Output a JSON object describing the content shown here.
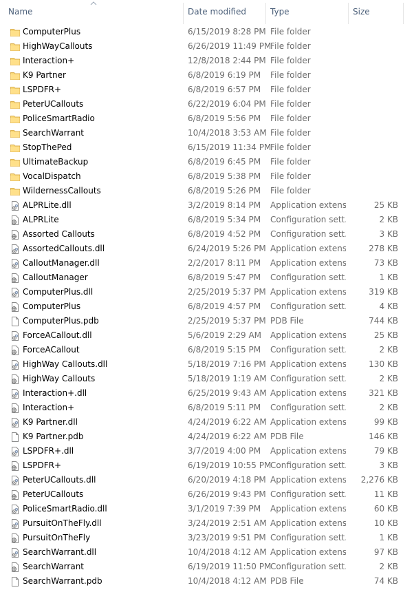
{
  "header": {
    "name": "Name",
    "date_modified": "Date modified",
    "type": "Type",
    "size": "Size"
  },
  "files": [
    {
      "name": "ComputerPlus",
      "date": "6/15/2019 8:28 PM",
      "type": "File folder",
      "size": "",
      "icon": "folder-icon"
    },
    {
      "name": "HighWayCallouts",
      "date": "6/26/2019 11:49 PM",
      "type": "File folder",
      "size": "",
      "icon": "folder-icon"
    },
    {
      "name": "Interaction+",
      "date": "12/8/2018 2:44 PM",
      "type": "File folder",
      "size": "",
      "icon": "folder-icon"
    },
    {
      "name": "K9 Partner",
      "date": "6/8/2019 6:19 PM",
      "type": "File folder",
      "size": "",
      "icon": "folder-icon"
    },
    {
      "name": "LSPDFR+",
      "date": "6/8/2019 6:57 PM",
      "type": "File folder",
      "size": "",
      "icon": "folder-icon"
    },
    {
      "name": "PeterUCallouts",
      "date": "6/22/2019 6:04 PM",
      "type": "File folder",
      "size": "",
      "icon": "folder-icon"
    },
    {
      "name": "PoliceSmartRadio",
      "date": "6/8/2019 5:56 PM",
      "type": "File folder",
      "size": "",
      "icon": "folder-icon"
    },
    {
      "name": "SearchWarrant",
      "date": "10/4/2018 3:53 AM",
      "type": "File folder",
      "size": "",
      "icon": "folder-icon"
    },
    {
      "name": "StopThePed",
      "date": "6/15/2019 11:34 PM",
      "type": "File folder",
      "size": "",
      "icon": "folder-icon"
    },
    {
      "name": "UltimateBackup",
      "date": "6/8/2019 6:45 PM",
      "type": "File folder",
      "size": "",
      "icon": "folder-icon"
    },
    {
      "name": "VocalDispatch",
      "date": "6/8/2019 5:38 PM",
      "type": "File folder",
      "size": "",
      "icon": "folder-icon"
    },
    {
      "name": "WildernessCallouts",
      "date": "6/8/2019 5:26 PM",
      "type": "File folder",
      "size": "",
      "icon": "folder-icon"
    },
    {
      "name": "ALPRLite.dll",
      "date": "3/2/2019 8:14 PM",
      "type": "Application extens...",
      "size": "25 KB",
      "icon": "dll-icon"
    },
    {
      "name": "ALPRLite",
      "date": "6/8/2019 5:34 PM",
      "type": "Configuration sett...",
      "size": "2 KB",
      "icon": "config-icon"
    },
    {
      "name": "Assorted Callouts",
      "date": "6/8/2019 4:52 PM",
      "type": "Configuration sett...",
      "size": "3 KB",
      "icon": "config-icon"
    },
    {
      "name": "AssortedCallouts.dll",
      "date": "6/24/2019 5:26 PM",
      "type": "Application extens...",
      "size": "278 KB",
      "icon": "dll-icon"
    },
    {
      "name": "CalloutManager.dll",
      "date": "2/2/2017 8:11 PM",
      "type": "Application extens...",
      "size": "73 KB",
      "icon": "dll-icon"
    },
    {
      "name": "CalloutManager",
      "date": "6/8/2019 5:47 PM",
      "type": "Configuration sett...",
      "size": "1 KB",
      "icon": "config-icon"
    },
    {
      "name": "ComputerPlus.dll",
      "date": "2/25/2019 5:37 PM",
      "type": "Application extens...",
      "size": "319 KB",
      "icon": "dll-icon"
    },
    {
      "name": "ComputerPlus",
      "date": "6/8/2019 4:57 PM",
      "type": "Configuration sett...",
      "size": "4 KB",
      "icon": "config-icon"
    },
    {
      "name": "ComputerPlus.pdb",
      "date": "2/25/2019 5:37 PM",
      "type": "PDB File",
      "size": "744 KB",
      "icon": "blank-file-icon"
    },
    {
      "name": "ForceACallout.dll",
      "date": "5/6/2019 2:29 AM",
      "type": "Application extens...",
      "size": "25 KB",
      "icon": "dll-icon"
    },
    {
      "name": "ForceACallout",
      "date": "6/8/2019 5:15 PM",
      "type": "Configuration sett...",
      "size": "2 KB",
      "icon": "config-icon"
    },
    {
      "name": "HighWay Callouts.dll",
      "date": "5/18/2019 7:16 PM",
      "type": "Application extens...",
      "size": "130 KB",
      "icon": "dll-icon"
    },
    {
      "name": "HighWay Callouts",
      "date": "5/18/2019 1:19 AM",
      "type": "Configuration sett...",
      "size": "2 KB",
      "icon": "config-icon"
    },
    {
      "name": "Interaction+.dll",
      "date": "6/25/2019 9:43 AM",
      "type": "Application extens...",
      "size": "321 KB",
      "icon": "dll-icon"
    },
    {
      "name": "Interaction+",
      "date": "6/8/2019 5:11 PM",
      "type": "Configuration sett...",
      "size": "2 KB",
      "icon": "config-icon"
    },
    {
      "name": "K9 Partner.dll",
      "date": "4/24/2019 6:22 AM",
      "type": "Application extens...",
      "size": "99 KB",
      "icon": "dll-icon"
    },
    {
      "name": "K9 Partner.pdb",
      "date": "4/24/2019 6:22 AM",
      "type": "PDB File",
      "size": "146 KB",
      "icon": "blank-file-icon"
    },
    {
      "name": "LSPDFR+.dll",
      "date": "3/7/2019 4:00 PM",
      "type": "Application extens...",
      "size": "79 KB",
      "icon": "dll-icon"
    },
    {
      "name": "LSPDFR+",
      "date": "6/19/2019 10:55 PM",
      "type": "Configuration sett...",
      "size": "3 KB",
      "icon": "config-icon"
    },
    {
      "name": "PeterUCallouts.dll",
      "date": "6/20/2019 4:18 PM",
      "type": "Application extens...",
      "size": "2,276 KB",
      "icon": "dll-icon"
    },
    {
      "name": "PeterUCallouts",
      "date": "6/26/2019 9:43 PM",
      "type": "Configuration sett...",
      "size": "11 KB",
      "icon": "config-icon"
    },
    {
      "name": "PoliceSmartRadio.dll",
      "date": "3/1/2019 7:39 PM",
      "type": "Application extens...",
      "size": "60 KB",
      "icon": "dll-icon"
    },
    {
      "name": "PursuitOnTheFly.dll",
      "date": "3/24/2019 2:51 AM",
      "type": "Application extens...",
      "size": "10 KB",
      "icon": "dll-icon"
    },
    {
      "name": "PursuitOnTheFly",
      "date": "3/23/2019 9:51 PM",
      "type": "Configuration sett...",
      "size": "1 KB",
      "icon": "config-icon"
    },
    {
      "name": "SearchWarrant.dll",
      "date": "10/4/2018 4:12 AM",
      "type": "Application extens...",
      "size": "97 KB",
      "icon": "dll-icon"
    },
    {
      "name": "SearchWarrant",
      "date": "6/19/2019 11:50 PM",
      "type": "Configuration sett...",
      "size": "2 KB",
      "icon": "config-icon"
    },
    {
      "name": "SearchWarrant.pdb",
      "date": "10/4/2018 4:12 AM",
      "type": "PDB File",
      "size": "74 KB",
      "icon": "blank-file-icon"
    }
  ]
}
